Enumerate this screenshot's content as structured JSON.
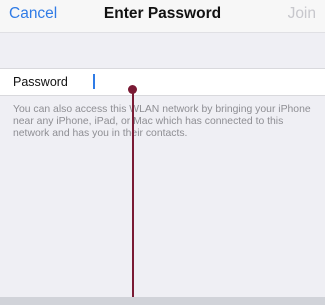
{
  "navbar": {
    "cancel_label": "Cancel",
    "title": "Enter Password",
    "join_label": "Join"
  },
  "password_field": {
    "label": "Password",
    "value": ""
  },
  "help_text": "You can also access this WLAN network by bringing your iPhone near any iPhone, iPad, or Mac which has connected to this network and has you in their contacts.",
  "colors": {
    "accent": "#2f7be6",
    "disabled": "#c7c7cc",
    "background": "#efeff4",
    "pointer": "#7a1a34"
  }
}
